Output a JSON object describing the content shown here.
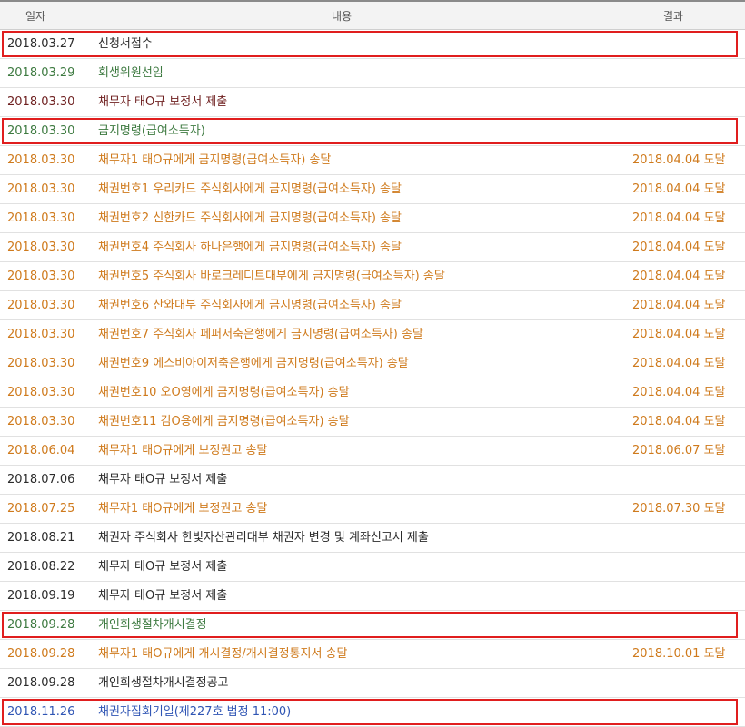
{
  "columns": {
    "date": "일자",
    "content": "내용",
    "result": "결과"
  },
  "colors": {
    "black": "#2b2b2b",
    "green": "#3d7a40",
    "orange": "#cf7a1c",
    "maroon": "#6e1f1f",
    "blue": "#2f55b4",
    "highlight_box": "#e01e1e"
  },
  "rows": [
    {
      "date": "2018.03.27",
      "content": "신청서접수",
      "result": "",
      "color": "#2b2b2b",
      "highlighted": true
    },
    {
      "date": "2018.03.29",
      "content": "회생위원선임",
      "result": "",
      "color": "#3d7a40",
      "highlighted": false
    },
    {
      "date": "2018.03.30",
      "content": "채무자 태O규 보정서 제출",
      "result": "",
      "color": "#6e1f1f",
      "highlighted": false
    },
    {
      "date": "2018.03.30",
      "content": "금지명령(급여소득자)",
      "result": "",
      "color": "#3d7a40",
      "highlighted": true
    },
    {
      "date": "2018.03.30",
      "content": "채무자1 태O규에게 금지명령(급여소득자) 송달",
      "result": "2018.04.04 도달",
      "color": "#cf7a1c",
      "highlighted": false
    },
    {
      "date": "2018.03.30",
      "content": "채권번호1 우리카드 주식회사에게 금지명령(급여소득자) 송달",
      "result": "2018.04.04 도달",
      "color": "#cf7a1c",
      "highlighted": false
    },
    {
      "date": "2018.03.30",
      "content": "채권번호2 신한카드 주식회사에게 금지명령(급여소득자) 송달",
      "result": "2018.04.04 도달",
      "color": "#cf7a1c",
      "highlighted": false
    },
    {
      "date": "2018.03.30",
      "content": "채권번호4 주식회사 하나은행에게 금지명령(급여소득자) 송달",
      "result": "2018.04.04 도달",
      "color": "#cf7a1c",
      "highlighted": false
    },
    {
      "date": "2018.03.30",
      "content": "채권번호5 주식회사 바로크레디트대부에게 금지명령(급여소득자) 송달",
      "result": "2018.04.04 도달",
      "color": "#cf7a1c",
      "highlighted": false
    },
    {
      "date": "2018.03.30",
      "content": "채권번호6 산와대부 주식회사에게 금지명령(급여소득자) 송달",
      "result": "2018.04.04 도달",
      "color": "#cf7a1c",
      "highlighted": false
    },
    {
      "date": "2018.03.30",
      "content": "채권번호7 주식회사 페퍼저축은행에게 금지명령(급여소득자) 송달",
      "result": "2018.04.04 도달",
      "color": "#cf7a1c",
      "highlighted": false
    },
    {
      "date": "2018.03.30",
      "content": "채권번호9 에스비아이저축은행에게 금지명령(급여소득자) 송달",
      "result": "2018.04.04 도달",
      "color": "#cf7a1c",
      "highlighted": false
    },
    {
      "date": "2018.03.30",
      "content": "채권번호10 오O영에게 금지명령(급여소득자) 송달",
      "result": "2018.04.04 도달",
      "color": "#cf7a1c",
      "highlighted": false
    },
    {
      "date": "2018.03.30",
      "content": "채권번호11 김O용에게 금지명령(급여소득자) 송달",
      "result": "2018.04.04 도달",
      "color": "#cf7a1c",
      "highlighted": false
    },
    {
      "date": "2018.06.04",
      "content": "채무자1 태O규에게 보정권고 송달",
      "result": "2018.06.07 도달",
      "color": "#cf7a1c",
      "highlighted": false
    },
    {
      "date": "2018.07.06",
      "content": "채무자 태O규 보정서 제출",
      "result": "",
      "color": "#2b2b2b",
      "highlighted": false
    },
    {
      "date": "2018.07.25",
      "content": "채무자1 태O규에게 보정권고 송달",
      "result": "2018.07.30 도달",
      "color": "#cf7a1c",
      "highlighted": false
    },
    {
      "date": "2018.08.21",
      "content": "채권자 주식회사 한빛자산관리대부 채권자 변경 및 계좌신고서 제출",
      "result": "",
      "color": "#2b2b2b",
      "highlighted": false
    },
    {
      "date": "2018.08.22",
      "content": "채무자 태O규 보정서 제출",
      "result": "",
      "color": "#2b2b2b",
      "highlighted": false
    },
    {
      "date": "2018.09.19",
      "content": "채무자 태O규 보정서 제출",
      "result": "",
      "color": "#2b2b2b",
      "highlighted": false
    },
    {
      "date": "2018.09.28",
      "content": "개인회생절차개시결정",
      "result": "",
      "color": "#3d7a40",
      "highlighted": true
    },
    {
      "date": "2018.09.28",
      "content": "채무자1 태O규에게 개시결정/개시결정통지서 송달",
      "result": "2018.10.01 도달",
      "color": "#cf7a1c",
      "highlighted": false
    },
    {
      "date": "2018.09.28",
      "content": "개인회생절차개시결정공고",
      "result": "",
      "color": "#2b2b2b",
      "highlighted": false
    },
    {
      "date": "2018.11.26",
      "content": "채권자집회기일(제227호 법정 11:00)",
      "result": "",
      "color": "#2f55b4",
      "highlighted": true
    }
  ]
}
